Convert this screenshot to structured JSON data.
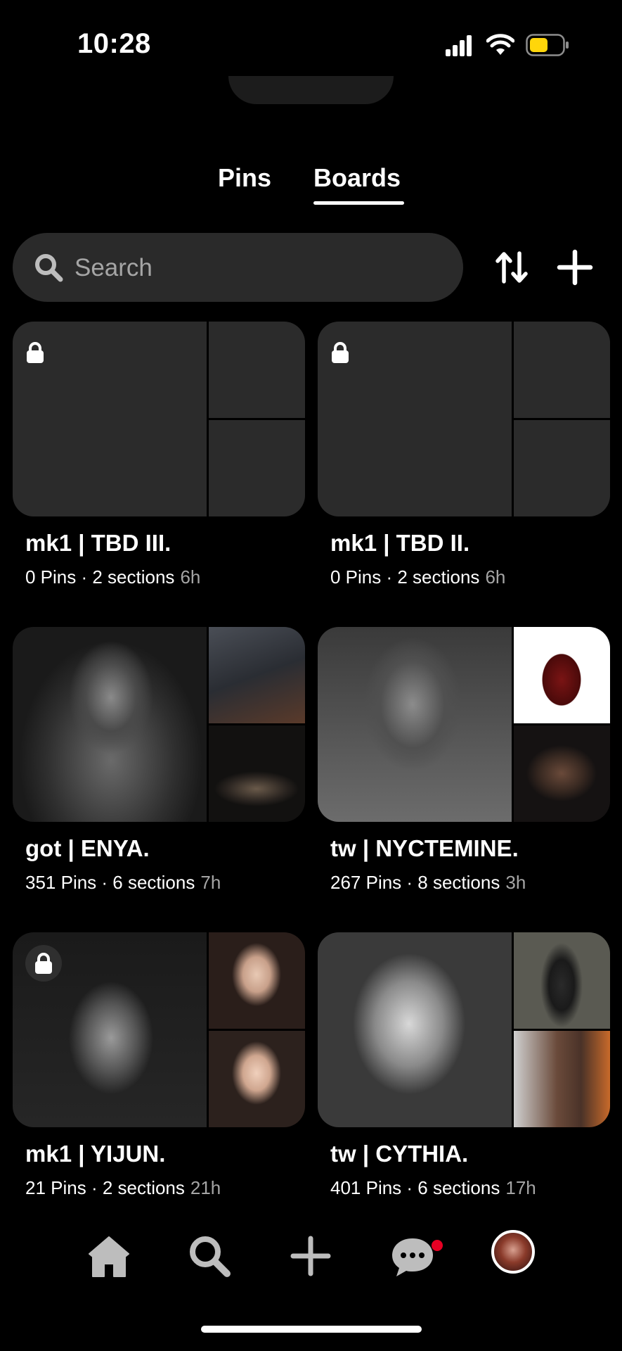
{
  "status_bar": {
    "time": "10:28",
    "battery_color": "#ffd60a"
  },
  "tabs": [
    {
      "label": "Pins",
      "active": false
    },
    {
      "label": "Boards",
      "active": true
    }
  ],
  "search": {
    "placeholder": "Search"
  },
  "boards": [
    {
      "title": "mk1 | TBD III.",
      "pins": "0 Pins",
      "sections": "2 sections",
      "meta": "0 Pins · 2 sections",
      "age": "6h",
      "locked": true,
      "empty": true
    },
    {
      "title": "mk1 | TBD II.",
      "pins": "0 Pins",
      "sections": "2 sections",
      "meta": "0 Pins · 2 sections",
      "age": "6h",
      "locked": true,
      "empty": true
    },
    {
      "title": "got | ENYA.",
      "pins": "351 Pins",
      "sections": "6 sections",
      "meta": "351 Pins · 6 sections",
      "age": "7h",
      "locked": false,
      "empty": false
    },
    {
      "title": "tw | NYCTEMINE.",
      "pins": "267 Pins",
      "sections": "8 sections",
      "meta": "267 Pins · 8 sections",
      "age": "3h",
      "locked": false,
      "empty": false
    },
    {
      "title": "mk1 | YIJUN.",
      "pins": "21 Pins",
      "sections": "2 sections",
      "meta": "21 Pins · 2 sections",
      "age": "21h",
      "locked": true,
      "empty": false
    },
    {
      "title": "tw | CYTHIA.",
      "pins": "401 Pins",
      "sections": "6 sections",
      "meta": "401 Pins · 6 sections",
      "age": "17h",
      "locked": false,
      "empty": false
    }
  ],
  "nav": {
    "items": [
      "home-icon",
      "search-icon",
      "plus-icon",
      "chat-icon",
      "profile-avatar"
    ],
    "notification_color": "#e60023"
  },
  "icons": [
    "lock-icon",
    "sort-icon",
    "plus-icon",
    "search-icon"
  ]
}
